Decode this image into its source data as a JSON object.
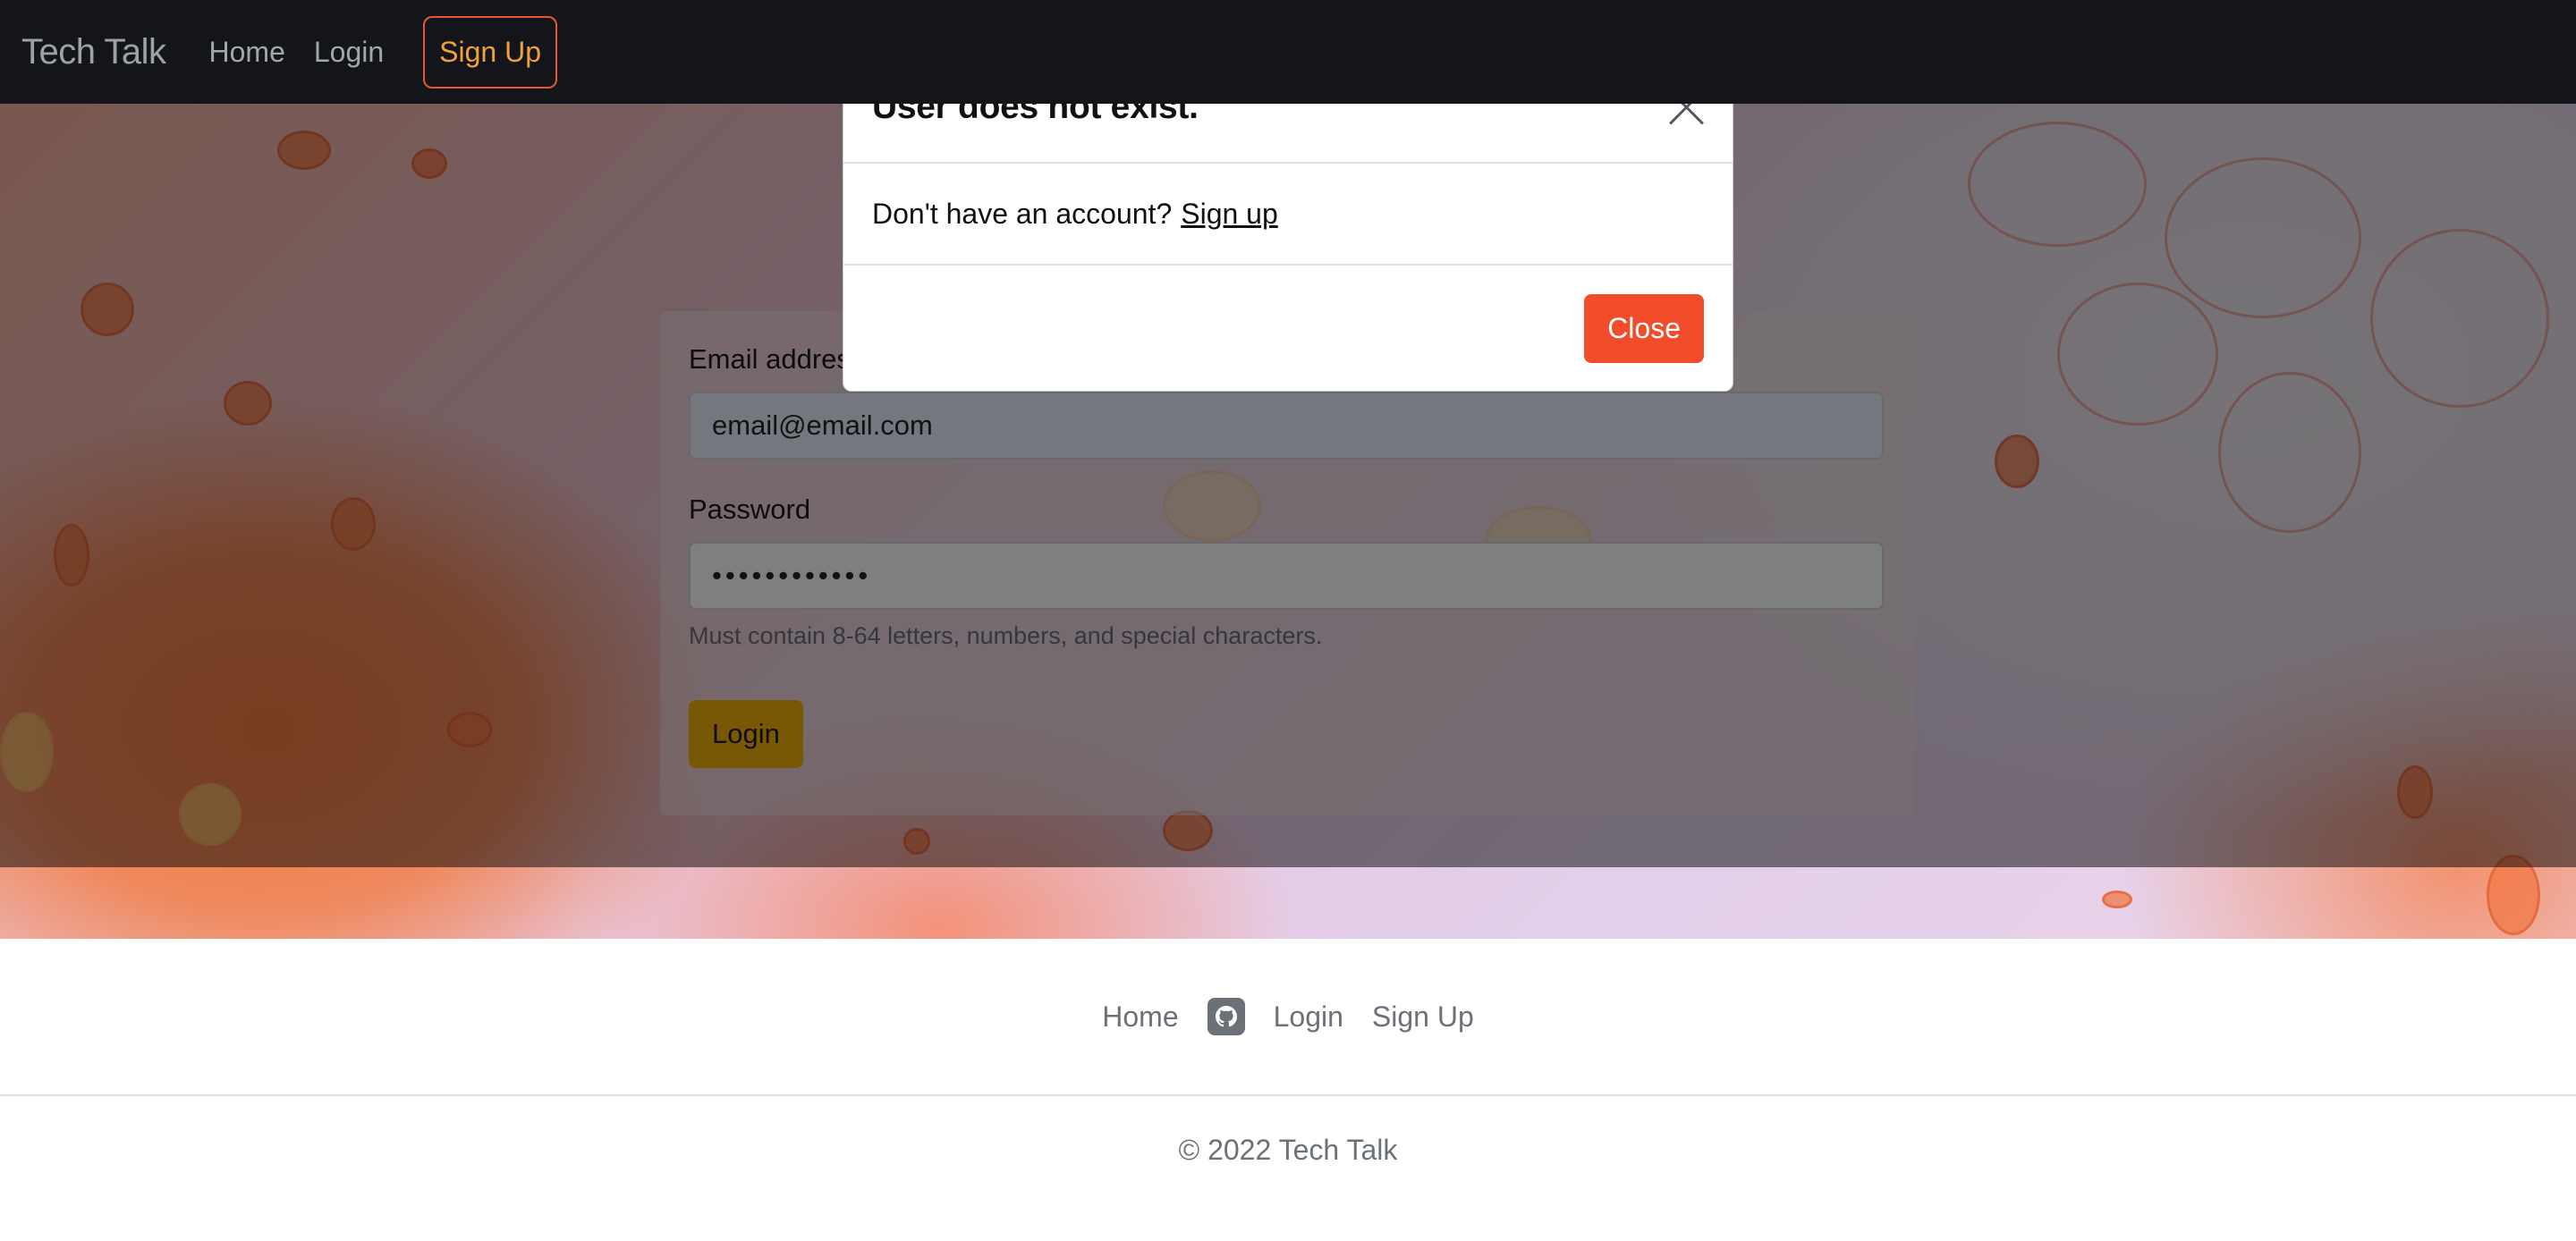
{
  "navbar": {
    "brand": "Tech Talk",
    "links": [
      "Home",
      "Login"
    ],
    "signup": "Sign Up"
  },
  "form": {
    "email_label": "Email address",
    "email_value": "email@email.com",
    "password_label": "Password",
    "password_value": "••••••••••••",
    "password_help": "Must contain 8-64 letters, numbers, and special characters.",
    "login_button": "Login"
  },
  "modal": {
    "title": "User does not exist.",
    "body_text": "Don't have an account?",
    "signup_link": "Sign up",
    "close_button": "Close"
  },
  "footer": {
    "links": [
      "Home",
      "Login",
      "Sign Up"
    ],
    "github_icon": "github-icon",
    "copyright": "© 2022 Tech Talk"
  },
  "colors": {
    "navbar_bg": "#14151a",
    "signup_accent": "#f0a23a",
    "login_button": "#f1b10a",
    "close_button": "#f24d2b"
  }
}
